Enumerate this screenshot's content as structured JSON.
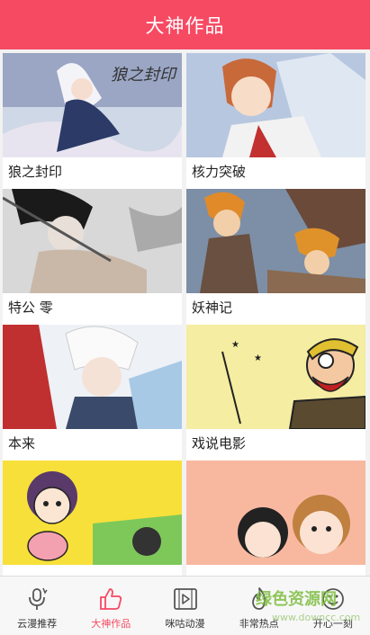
{
  "header": {
    "title": "大神作品"
  },
  "works": [
    {
      "title": "狼之封印"
    },
    {
      "title": "核力突破"
    },
    {
      "title": "特公 零"
    },
    {
      "title": "妖神记"
    },
    {
      "title": "本来"
    },
    {
      "title": "戏说电影"
    },
    {
      "title": ""
    },
    {
      "title": ""
    }
  ],
  "tabs": [
    {
      "label": "云漫推荐",
      "icon": "microphone-icon"
    },
    {
      "label": "大神作品",
      "icon": "thumbs-up-icon"
    },
    {
      "label": "咪咕动漫",
      "icon": "film-play-icon"
    },
    {
      "label": "非常热点",
      "icon": "flame-icon"
    },
    {
      "label": "开心一刻",
      "icon": "smile-icon"
    }
  ],
  "active_tab": 1,
  "watermark": {
    "main": "绿色资源网",
    "sub": "www.downcc.com"
  },
  "colors": {
    "accent": "#f64a63",
    "watermark": "#7dbd3f"
  }
}
